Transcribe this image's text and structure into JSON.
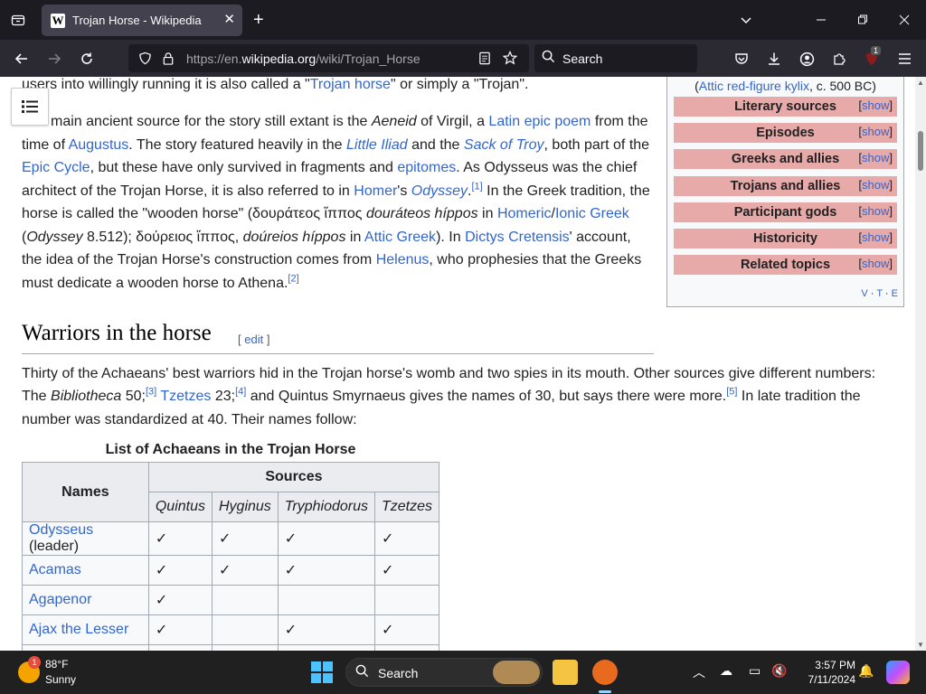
{
  "browser": {
    "tab": {
      "title": "Trojan Horse - Wikipedia",
      "favicon": "W"
    },
    "url": {
      "prefix": "https://en.",
      "domain": "wikipedia.org",
      "path": "/wiki/Trojan_Horse"
    },
    "search_placeholder": "Search",
    "extension_badge": "1"
  },
  "article": {
    "intro_tail": "users into willingly running it is also called a \"",
    "intro_link": "Trojan horse",
    "intro_end": "\" or simply a \"Trojan\".",
    "p1": {
      "l1a": "The main ancient source for the story still extant is the ",
      "aeneid": "Aeneid",
      "l1b": " of Virgil, a ",
      "latin_epic": "Latin epic poem",
      "l1c": " from the",
      "l2a": "time of ",
      "augustus": "Augustus",
      "l2b": ". The story featured heavily in the ",
      "little_iliad": "Little Iliad",
      "l2c": " and the ",
      "sack_of_troy": "Sack of Troy",
      "l2d": ", both part of the",
      "epic_cycle": "Epic Cycle",
      "l3a": ", but these have only survived in fragments and ",
      "epitomes": "epitomes",
      "l3b": ". As Odysseus was the chief",
      "l4a": "architect of the Trojan Horse, it is also referred to in ",
      "homer": "Homer",
      "l4b": "'s ",
      "odyssey": "Odyssey",
      "ref1": "[1]",
      "l4c": " In the Greek tradition, the",
      "l5a": "horse is called the \"wooden horse\" (δουράτεος ἵππος ",
      "dourateos": "douráteos híppos",
      "l5b": " in ",
      "homeric": "Homeric",
      "slash": "/",
      "ionic": "Ionic Greek",
      "l6a": "(",
      "odyssey2": "Odyssey",
      "l6b": " 8.512); δούρειος ἵππος, ",
      "doureios": "doúreios híppos",
      "l6c": " in ",
      "attic": "Attic Greek",
      "l6d": "). In ",
      "dictys": "Dictys Cretensis",
      "l6e": "' account,",
      "l7a": "the idea of the Trojan Horse's construction comes from ",
      "helenus": "Helenus",
      "l7b": ", who prophesies that the Greeks",
      "l8a": "must dedicate a wooden horse to Athena.",
      "ref2": "[2]"
    },
    "section_title": "Warriors in the horse",
    "edit_label": "edit",
    "p2": {
      "l1": "Thirty of the Achaeans' best warriors hid in the Trojan horse's womb and two spies in its mouth. Other sources give different numbers:",
      "l2a": "The ",
      "bibliotheca": "Bibliotheca",
      "l2b": " 50;",
      "ref3": "[3]",
      "tzetzes": "Tzetzes",
      "l2c": " 23;",
      "ref4": "[4]",
      "l2d": " and Quintus Smyrnaeus gives the names of 30, but says there were more.",
      "ref5": "[5]",
      "l2e": " In late tradition the",
      "l3": "number was standardized at 40. Their names follow:"
    },
    "table": {
      "caption": "List of Achaeans in the Trojan Horse",
      "names_header": "Names",
      "sources_header": "Sources",
      "sources": [
        "Quintus",
        "Hyginus",
        "Tryphiodorus",
        "Tzetzes"
      ],
      "rows": [
        {
          "name": "Odysseus",
          "suffix": " (leader)",
          "marks": [
            "✓",
            "✓",
            "✓",
            "✓"
          ]
        },
        {
          "name": "Acamas",
          "suffix": "",
          "marks": [
            "✓",
            "✓",
            "✓",
            "✓"
          ]
        },
        {
          "name": "Agapenor",
          "suffix": "",
          "marks": [
            "✓",
            "",
            "",
            ""
          ]
        },
        {
          "name": "Ajax the Lesser",
          "suffix": "",
          "marks": [
            "✓",
            "",
            "✓",
            "✓"
          ]
        }
      ]
    }
  },
  "navbox": {
    "caption_open": "(",
    "caption_link": "Attic red-figure kylix",
    "caption_rest": ", c. 500 BC)",
    "show_label": "show",
    "rows": [
      "Literary sources",
      "Episodes",
      "Greeks and allies",
      "Trojans and allies",
      "Participant gods",
      "Historicity",
      "Related topics"
    ],
    "vte": [
      "V",
      "T",
      "E"
    ]
  },
  "taskbar": {
    "temperature": "88°F",
    "condition": "Sunny",
    "weather_badge": "1",
    "search_placeholder": "Search",
    "time": "3:57 PM",
    "date": "7/11/2024"
  }
}
